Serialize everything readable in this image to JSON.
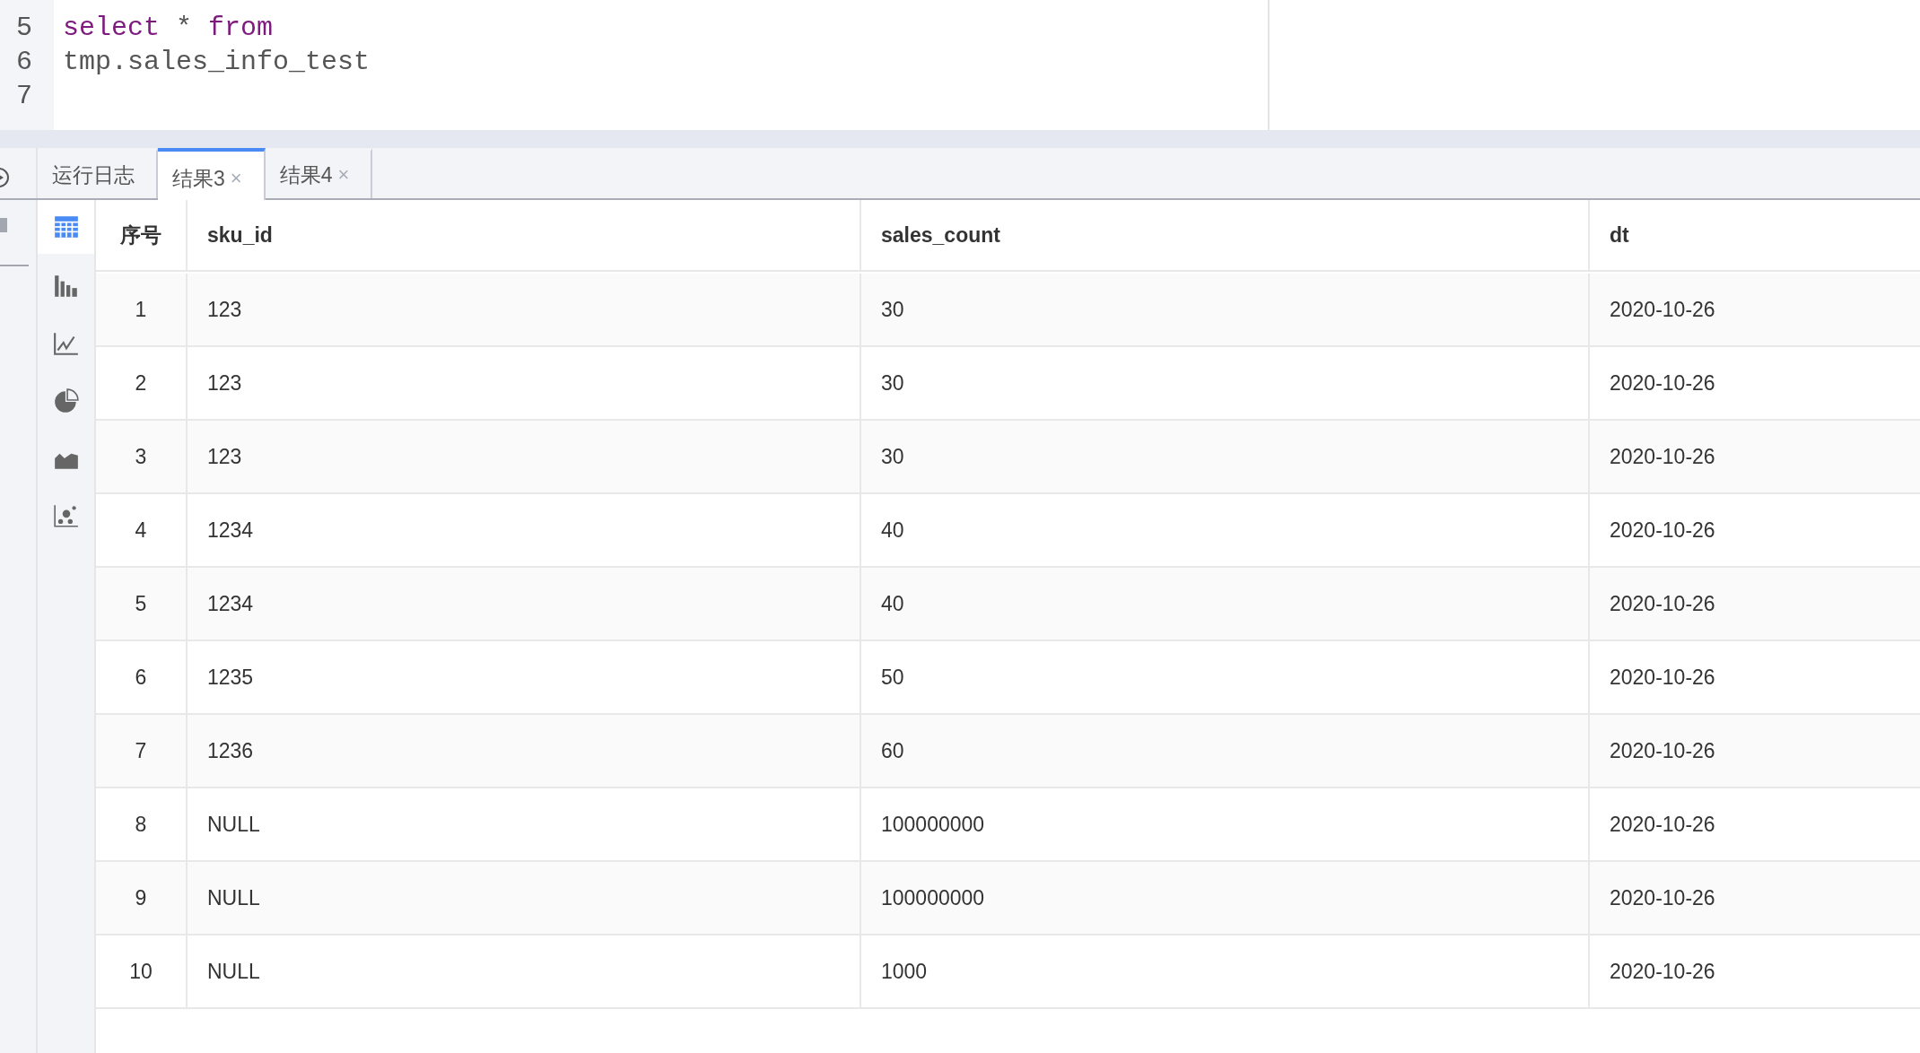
{
  "editor": {
    "lines": [
      {
        "number": "5",
        "tokens": [
          {
            "text": "select",
            "kind": "keyword"
          },
          {
            "text": " * ",
            "kind": "plain"
          },
          {
            "text": "from",
            "kind": "keyword"
          }
        ]
      },
      {
        "number": "6",
        "tokens": [
          {
            "text": "tmp.sales_info_test",
            "kind": "plain"
          }
        ]
      },
      {
        "number": "7"
      }
    ]
  },
  "result_tabs": [
    {
      "label": "运行日志",
      "selected": false
    },
    {
      "label": "结果3",
      "close": "×",
      "selected": true
    },
    {
      "label": "结果4",
      "close": "×",
      "selected": false
    }
  ],
  "view_switcher": [
    {
      "kind": "table",
      "selected": true
    },
    {
      "kind": "bar",
      "selected": false
    },
    {
      "kind": "line",
      "selected": false
    },
    {
      "kind": "pie",
      "selected": false
    },
    {
      "kind": "area",
      "selected": false
    },
    {
      "kind": "scatter",
      "selected": false
    }
  ],
  "table": {
    "columns": [
      "序号",
      "sku_id",
      "sales_count",
      "dt"
    ],
    "rows": [
      [
        "1",
        "123",
        "30",
        "2020-10-26"
      ],
      [
        "2",
        "123",
        "30",
        "2020-10-26"
      ],
      [
        "3",
        "123",
        "30",
        "2020-10-26"
      ],
      [
        "4",
        "1234",
        "40",
        "2020-10-26"
      ],
      [
        "5",
        "1234",
        "40",
        "2020-10-26"
      ],
      [
        "6",
        "1235",
        "50",
        "2020-10-26"
      ],
      [
        "7",
        "1236",
        "60",
        "2020-10-26"
      ],
      [
        "8",
        "NULL",
        "100000000",
        "2020-10-26"
      ],
      [
        "9",
        "NULL",
        "100000000",
        "2020-10-26"
      ],
      [
        "10",
        "NULL",
        "1000",
        "2020-10-26"
      ]
    ]
  }
}
